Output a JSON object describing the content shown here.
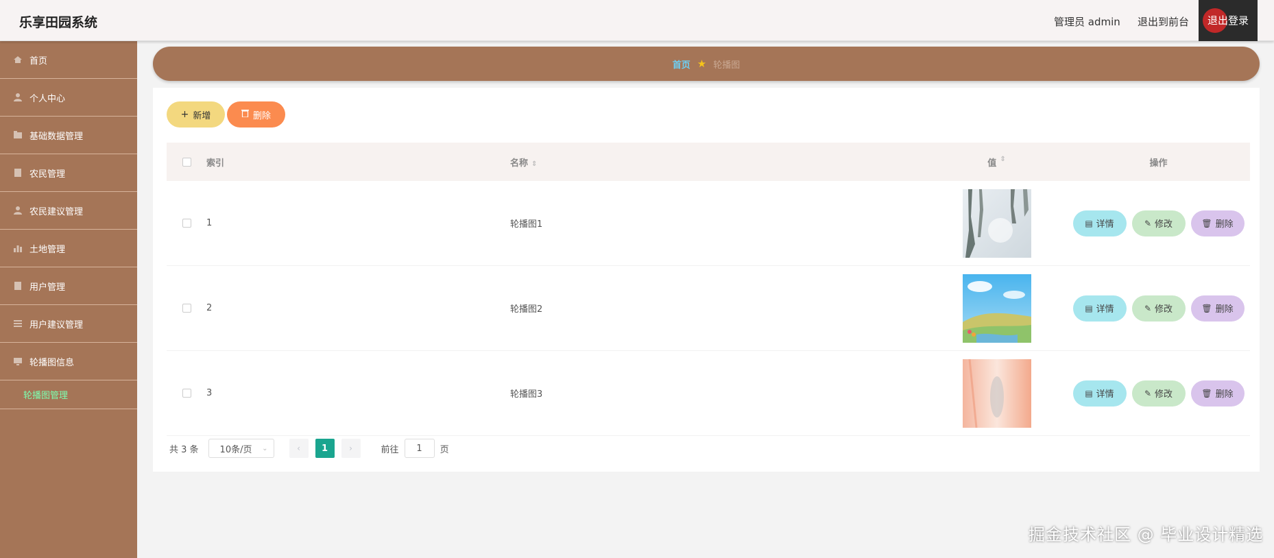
{
  "header": {
    "title": "乐享田园系统",
    "admin_label": "管理员 admin",
    "front_link": "退出到前台",
    "logout_label": "退出登录"
  },
  "sidebar": {
    "items": [
      {
        "label": "首页",
        "icon": "home-icon"
      },
      {
        "label": "个人中心",
        "icon": "user-icon"
      },
      {
        "label": "基础数据管理",
        "icon": "folder-icon"
      },
      {
        "label": "农民管理",
        "icon": "document-icon"
      },
      {
        "label": "农民建议管理",
        "icon": "user-icon"
      },
      {
        "label": "土地管理",
        "icon": "bar-chart-icon"
      },
      {
        "label": "用户管理",
        "icon": "document-icon"
      },
      {
        "label": "用户建议管理",
        "icon": "list-icon"
      },
      {
        "label": "轮播图信息",
        "icon": "monitor-icon"
      }
    ],
    "submenu_active": "轮播图管理"
  },
  "breadcrumb": {
    "home": "首页",
    "current": "轮播图"
  },
  "toolbar": {
    "add_label": "新增",
    "delete_label": "删除"
  },
  "table": {
    "headers": {
      "index": "索引",
      "name": "名称",
      "value": "值",
      "ops": "操作"
    },
    "rows": [
      {
        "index": "1",
        "name": "轮播图1"
      },
      {
        "index": "2",
        "name": "轮播图2"
      },
      {
        "index": "3",
        "name": "轮播图3"
      }
    ],
    "op_labels": {
      "detail": "详情",
      "edit": "修改",
      "remove": "删除"
    }
  },
  "pagination": {
    "total": "共 3 条",
    "page_size": "10条/页",
    "current_page": "1",
    "goto_label": "前往",
    "goto_value": "1",
    "page_suffix": "页"
  },
  "watermark": "掘金技术社区 @ 毕业设计精选",
  "colors": {
    "sidebar": "#a57557",
    "active_submenu": "#7dffb0",
    "add_button": "#f3d87f",
    "delete_button": "#fb8b4f",
    "pager_active": "#1aa58f"
  }
}
